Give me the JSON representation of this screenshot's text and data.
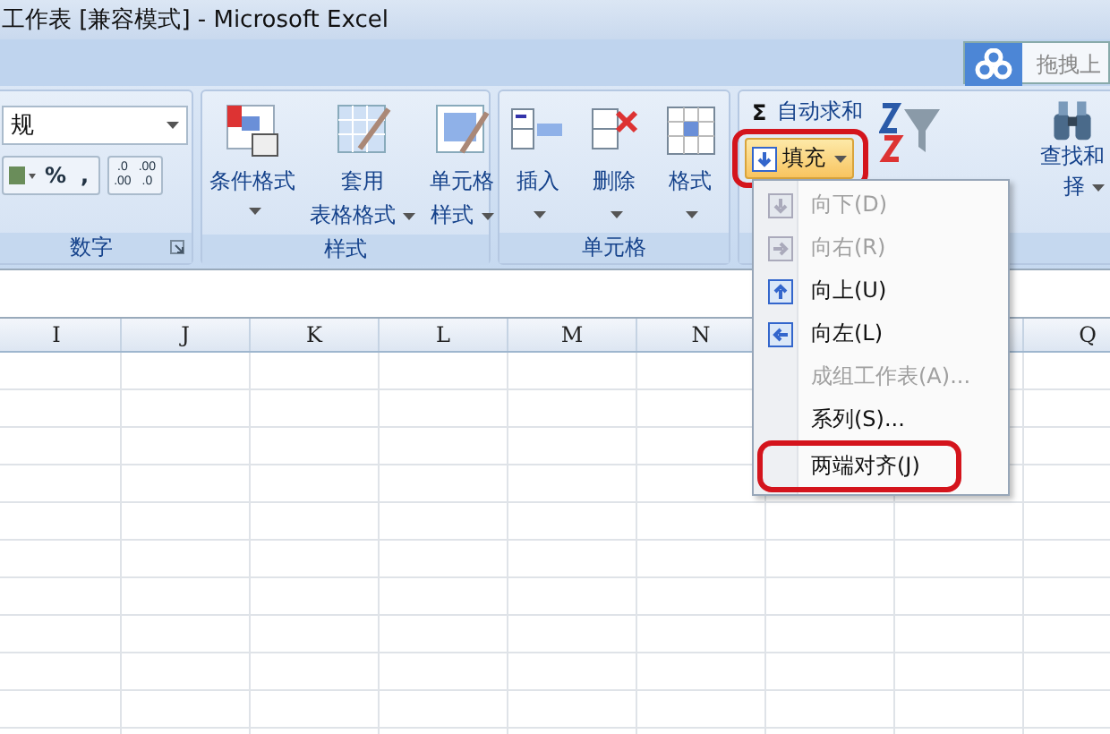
{
  "window": {
    "title": "工作表  [兼容模式] - Microsoft Excel"
  },
  "upload_button": {
    "label": "拖拽上"
  },
  "number_group": {
    "label": "数字",
    "format": "规",
    "buttons": [
      "%",
      ","
    ],
    "decimals": [
      {
        "top": ".0",
        "bottom": ".00"
      },
      {
        "top": ".00",
        "bottom": ".0"
      }
    ]
  },
  "styles_group": {
    "label": "样式",
    "buttons": [
      {
        "lines": [
          "条件格式"
        ],
        "kind": "conditional"
      },
      {
        "lines": [
          "套用",
          "表格格式"
        ],
        "kind": "table"
      },
      {
        "lines": [
          "单元格",
          "样式"
        ],
        "kind": "cell"
      }
    ]
  },
  "cells_group": {
    "label": "单元格",
    "buttons": [
      {
        "label": "插入",
        "kind": "insert"
      },
      {
        "label": "删除",
        "kind": "delete"
      },
      {
        "label": "格式",
        "kind": "format"
      }
    ]
  },
  "editing_group": {
    "autosum_symbol": "Σ",
    "autosum": "自动求和",
    "fill": {
      "label": "填充",
      "annotated": true
    },
    "find_lines": [
      "查找和",
      "择"
    ]
  },
  "fill_menu": [
    {
      "label": "向下(D)",
      "disabled": true,
      "kind": "down",
      "annotated": false
    },
    {
      "label": "向右(R)",
      "disabled": true,
      "kind": "right",
      "annotated": false
    },
    {
      "label": "向上(U)",
      "disabled": false,
      "kind": "up",
      "annotated": false
    },
    {
      "label": "向左(L)",
      "disabled": false,
      "kind": "left",
      "annotated": false
    },
    {
      "label": "成组工作表(A)...",
      "disabled": true,
      "kind": "plain",
      "annotated": false
    },
    {
      "label": "系列(S)...",
      "disabled": false,
      "kind": "plain",
      "annotated": false
    },
    {
      "label": "两端对齐(J)",
      "disabled": false,
      "kind": "plain",
      "annotated": true
    }
  ],
  "columns": [
    "I",
    "J",
    "K",
    "L",
    "M",
    "N",
    "Q"
  ]
}
